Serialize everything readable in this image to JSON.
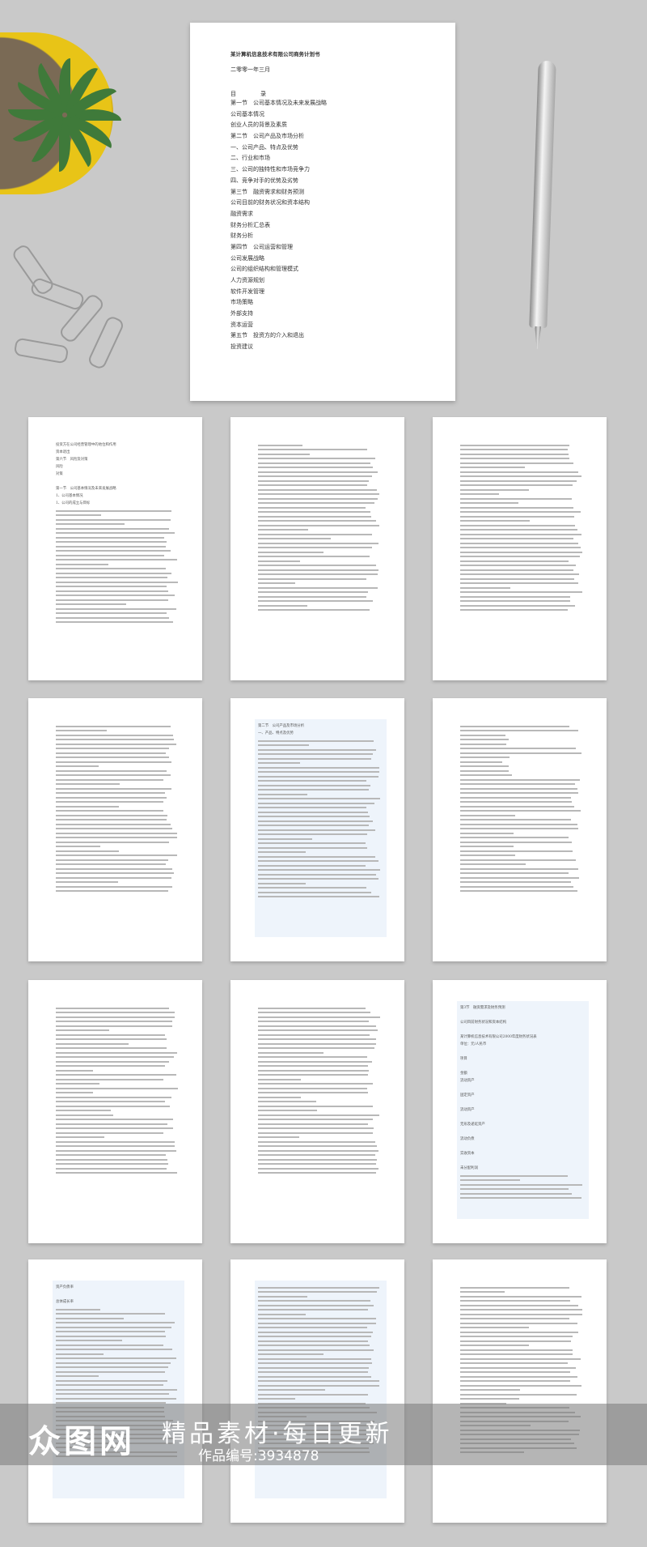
{
  "cover": {
    "title": "某计算机信息技术有限公司商务计划书",
    "date": "二零零一年三月",
    "toc_heading": "目录",
    "toc": [
      "第一节　公司基本情况及未来发展战略",
      "公司基本情况",
      "创业人员的背景及素质",
      "第二节　公司产品及市场分析",
      "一、公司产品、特点及优势",
      "二、行业和市场",
      "三、公司的独特性和市场竞争力",
      "四、竞争对手的优势及劣势",
      "第三节　融资需求和财务预测",
      "公司目前的财务状况和资本结构",
      "融资需求",
      "财务分析汇总表",
      "财务分析",
      "第四节　公司运营和管理",
      "公司发展战略",
      "公司的组织结构和管理模式",
      "人力资源规划",
      "软件开发管理",
      "市场策略",
      "外部支持",
      "资本运营",
      "第五节　投资方的介入和退出",
      "投资建议"
    ]
  },
  "pages": [
    {
      "lines": [
        "投资方在公司经营管理中的地位和作用",
        "资本退出",
        "第六节　风险及对策",
        "风险",
        "对策",
        "",
        "第一节　公司基本情况及未来发展战略",
        "1、公司基本情况",
        "1、公司的成立与目标"
      ],
      "tint": false
    },
    {
      "lines": [],
      "tint": false
    },
    {
      "lines": [],
      "tint": false
    },
    {
      "lines": [],
      "tint": false
    },
    {
      "lines": [
        "第二节　公司产品及市场分析",
        "一、产品、特点及优势"
      ],
      "tint": true
    },
    {
      "lines": [],
      "tint": false
    },
    {
      "lines": [],
      "tint": false
    },
    {
      "lines": [],
      "tint": false
    },
    {
      "lines": [
        "第3节　融资需求及财务预测",
        "",
        "公司目前财务状况和资本结构",
        "",
        "某计算机信息技术有限公司2000年度财务状况表",
        "单位：元/人民币",
        "",
        "项目",
        "",
        "金额",
        "流动资产",
        "",
        "固定资产",
        "",
        "流动资产",
        "",
        "无形及递延资产",
        "",
        "流动负债",
        "",
        "实收资本",
        "",
        "未分配利润"
      ],
      "tint": true
    },
    {
      "lines": [
        "资产负债率",
        "",
        "总体成长率"
      ],
      "tint": true
    },
    {
      "lines": [],
      "tint": true
    },
    {
      "lines": [],
      "tint": false
    }
  ],
  "watermark": {
    "logo": "众图网",
    "slogan": "精品素材·每日更新",
    "code": "作品编号:3934878"
  },
  "colors": {
    "background": "#c9c9c9",
    "bowl": "#e8c417",
    "tint": "#eef4fb"
  }
}
